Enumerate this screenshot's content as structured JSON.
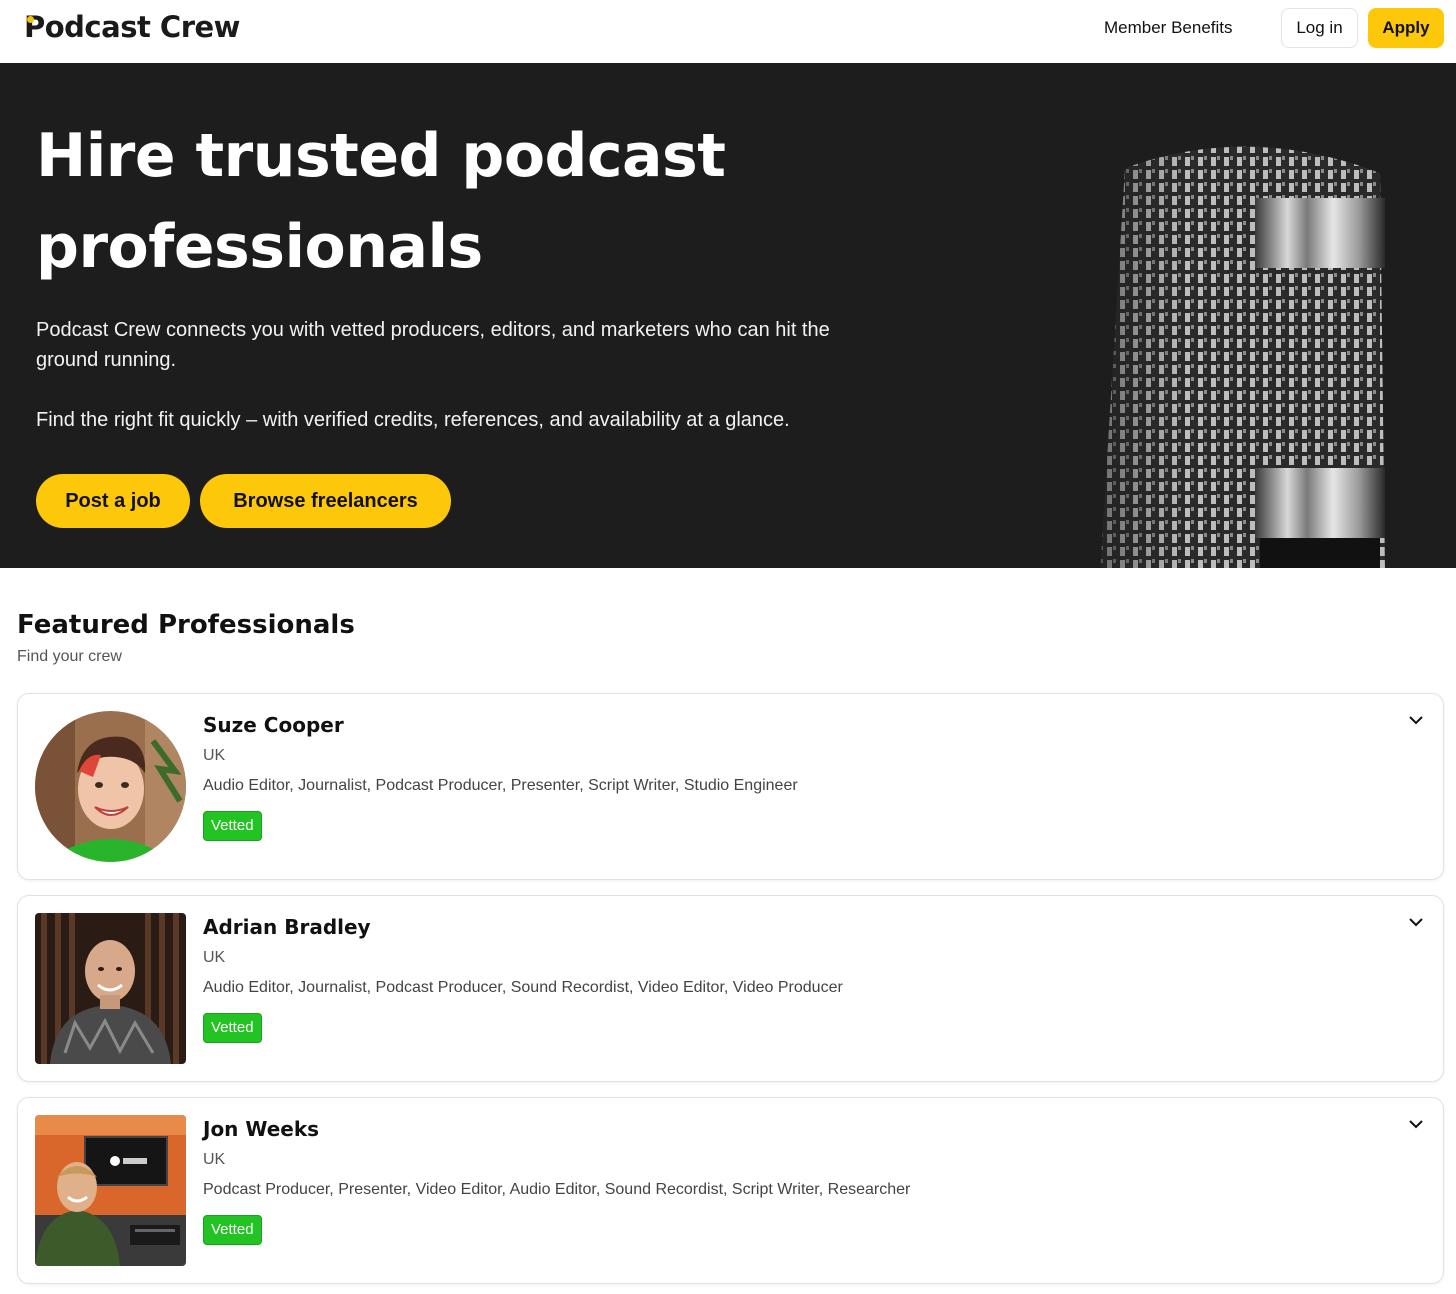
{
  "header": {
    "logo": "Podcast Crew",
    "nav_member_benefits": "Member Benefits",
    "login_label": "Log in",
    "apply_label": "Apply"
  },
  "hero": {
    "title_line1": "Hire trusted podcast",
    "title_line2": "professionals",
    "paragraph1": "Podcast Crew connects you with vetted producers, editors, and marketers who can hit the ground running.",
    "paragraph2": "Find the right fit quickly – with verified credits, references, and availability at a glance.",
    "post_job_label": "Post a job",
    "browse_label": "Browse freelancers"
  },
  "featured": {
    "title": "Featured Professionals",
    "subtitle": "Find your crew",
    "professionals": [
      {
        "name": "Suze Cooper",
        "location": "UK",
        "roles": "Audio Editor, Journalist, Podcast Producer, Presenter, Script Writer, Studio Engineer",
        "badge": "Vetted"
      },
      {
        "name": "Adrian Bradley",
        "location": "UK",
        "roles": "Audio Editor, Journalist, Podcast Producer, Sound Recordist, Video Editor, Video Producer",
        "badge": "Vetted"
      },
      {
        "name": "Jon Weeks",
        "location": "UK",
        "roles": "Podcast Producer, Presenter, Video Editor, Audio Editor, Sound Recordist, Script Writer, Researcher",
        "badge": "Vetted"
      }
    ]
  },
  "colors": {
    "accent_yellow": "#fdc80a",
    "hero_background": "#1d1d1d",
    "vetted_green": "#22c322"
  },
  "icons": [
    "chevron-down-icon",
    "microphone-image"
  ]
}
